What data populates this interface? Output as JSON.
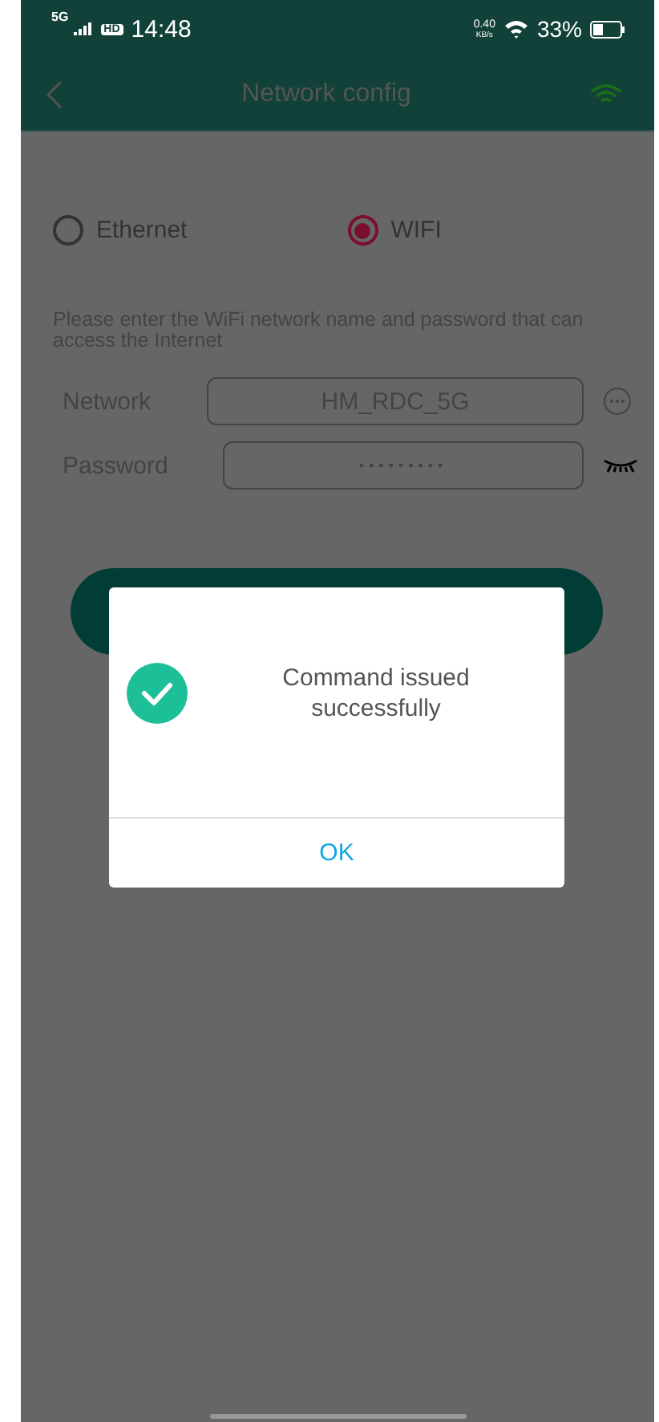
{
  "status_bar": {
    "network_type": "5G",
    "hd_badge": "HD",
    "time": "14:48",
    "speed": "0.40",
    "speed_unit": "KB/s",
    "battery": "33%"
  },
  "header": {
    "title": "Network config"
  },
  "connection_types": [
    {
      "label": "Ethernet",
      "selected": false
    },
    {
      "label": "WIFI",
      "selected": true
    }
  ],
  "hint": "Please enter the WiFi network name and password that can access the Internet",
  "fields": [
    {
      "kind": "network",
      "label": "Network",
      "value": "HM_RDC_5G"
    },
    {
      "kind": "password",
      "label": "Password",
      "value": "•••••••••"
    }
  ],
  "dialog": {
    "message": "Command issued successfully",
    "button": "OK"
  }
}
